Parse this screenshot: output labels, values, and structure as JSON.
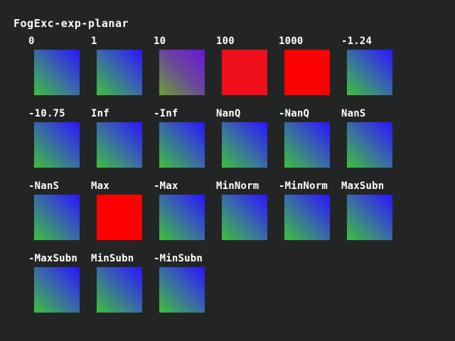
{
  "title": "FogExc-exp-planar",
  "colors": {
    "background": "#232524",
    "fog_red": "#ff0000",
    "fog_red_partial": "#ee0f1a"
  },
  "cells": [
    {
      "label": "0",
      "fill": "gradient"
    },
    {
      "label": "1",
      "fill": "gradient"
    },
    {
      "label": "10",
      "fill": "purple-fog"
    },
    {
      "label": "100",
      "fill": "red-fog"
    },
    {
      "label": "1000",
      "fill": "red"
    },
    {
      "label": "-1.24",
      "fill": "gradient"
    },
    {
      "label": "-10.75",
      "fill": "gradient"
    },
    {
      "label": "Inf",
      "fill": "gradient"
    },
    {
      "label": "-Inf",
      "fill": "gradient"
    },
    {
      "label": "NanQ",
      "fill": "gradient"
    },
    {
      "label": "-NanQ",
      "fill": "gradient"
    },
    {
      "label": "NanS",
      "fill": "gradient"
    },
    {
      "label": "-NanS",
      "fill": "gradient"
    },
    {
      "label": "Max",
      "fill": "red"
    },
    {
      "label": "-Max",
      "fill": "gradient"
    },
    {
      "label": "MinNorm",
      "fill": "gradient"
    },
    {
      "label": "-MinNorm",
      "fill": "gradient"
    },
    {
      "label": "MaxSubn",
      "fill": "gradient"
    },
    {
      "label": "-MaxSubn",
      "fill": "gradient"
    },
    {
      "label": "MinSubn",
      "fill": "gradient"
    },
    {
      "label": "-MinSubn",
      "fill": "gradient"
    }
  ]
}
